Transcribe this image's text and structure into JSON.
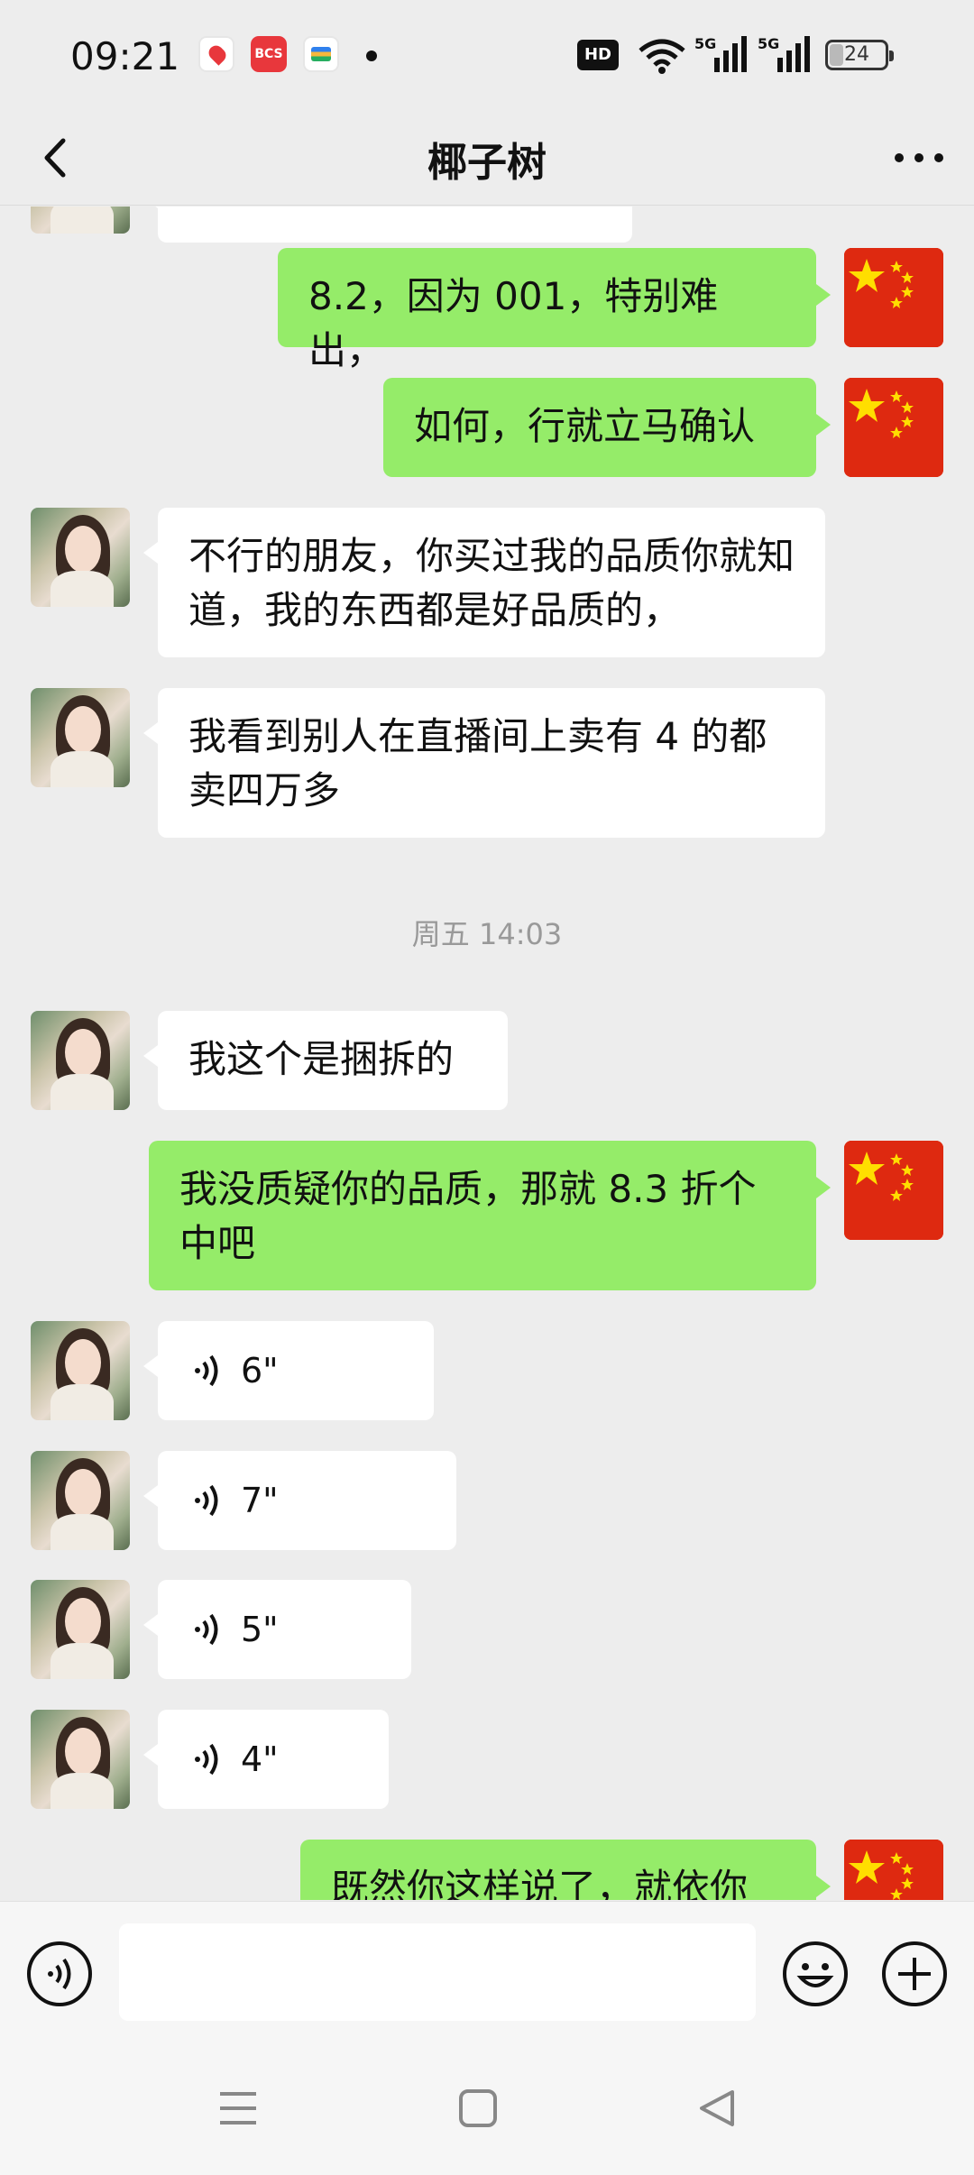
{
  "status_bar": {
    "time": "09:21",
    "apps": [
      "du",
      "BCS",
      "wallet"
    ],
    "hd_label": "HD",
    "signal_labels": [
      "5G",
      "5G"
    ],
    "battery": "24",
    "battery_level_percent": 24
  },
  "header": {
    "back_icon": "chevron-left-icon",
    "title": "椰子树",
    "more_icon": "more-icon"
  },
  "messages": [
    {
      "side": "out",
      "text": "8.2，因为 001，特别难出，"
    },
    {
      "side": "out",
      "text": "如何，行就立马确认"
    },
    {
      "side": "in",
      "text": "不行的朋友，你买过我的品质你就知道，我的东西都是好品质的，"
    },
    {
      "side": "in",
      "text": "我看到别人在直播间上卖有 4 的都卖四万多"
    },
    {
      "type": "timestamp",
      "text": "周五 14:03"
    },
    {
      "side": "in",
      "text": "我这个是捆拆的"
    },
    {
      "side": "out",
      "text": "我没质疑你的品质，那就 8.3 折个中吧"
    },
    {
      "side": "in",
      "type": "voice",
      "duration": "6\""
    },
    {
      "side": "in",
      "type": "voice",
      "duration": "7\""
    },
    {
      "side": "in",
      "type": "voice",
      "duration": "5\""
    },
    {
      "side": "in",
      "type": "voice",
      "duration": "4\""
    },
    {
      "side": "out",
      "text": "既然你这样说了，就依你"
    }
  ],
  "input_bar": {
    "voice_icon": "voice-input-icon",
    "emoji_icon": "emoji-icon",
    "plus_icon": "plus-icon",
    "value": ""
  },
  "nav_bar": {
    "icons": [
      "menu-icon",
      "home-icon",
      "back-triangle-icon"
    ]
  }
}
